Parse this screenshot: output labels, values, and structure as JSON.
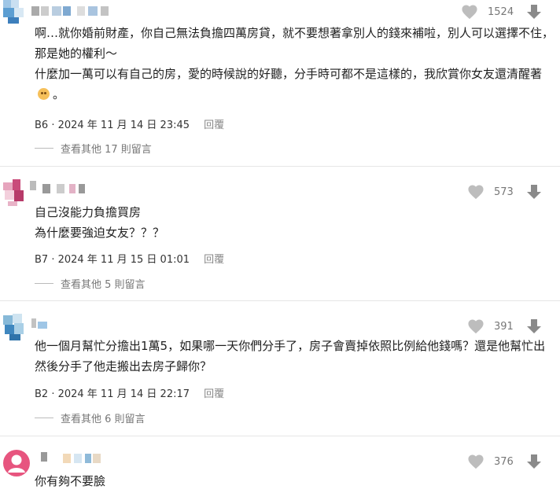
{
  "comments": [
    {
      "likes": "1524",
      "paragraphs": [
        "啊…就你婚前財產，你自己無法負擔四萬房貸，就不要想著拿別人的錢來補啦，別人可以選擇不住，那是她的權利～",
        "什麼加一萬可以有自己的房，愛的時候說的好聽，分手時可都不是這樣的，我欣賞你女友還清醒著",
        "。"
      ],
      "emoji": "pleading-face-emoji",
      "floor_date": "B6 · 2024 年 11 月 14 日 23:45",
      "reply": "回覆",
      "more": "查看其他 17 則留言"
    },
    {
      "likes": "573",
      "paragraphs": [
        "自己沒能力負擔買房",
        "為什麼要強迫女友？？？"
      ],
      "floor_date": "B7 · 2024 年 11 月 15 日 01:01",
      "reply": "回覆",
      "more": "查看其他 5 則留言"
    },
    {
      "likes": "391",
      "paragraphs": [
        "他一個月幫忙分擔出1萬5，如果哪一天你們分手了，房子會賣掉依照比例給他錢嗎？還是他幫忙出然後分手了他走搬出去房子歸你？"
      ],
      "floor_date": "B2 · 2024 年 11 月 14 日 22:17",
      "reply": "回覆",
      "more": "查看其他 6 則留言"
    },
    {
      "likes": "376",
      "paragraphs": [
        "你有夠不要臉"
      ]
    }
  ]
}
